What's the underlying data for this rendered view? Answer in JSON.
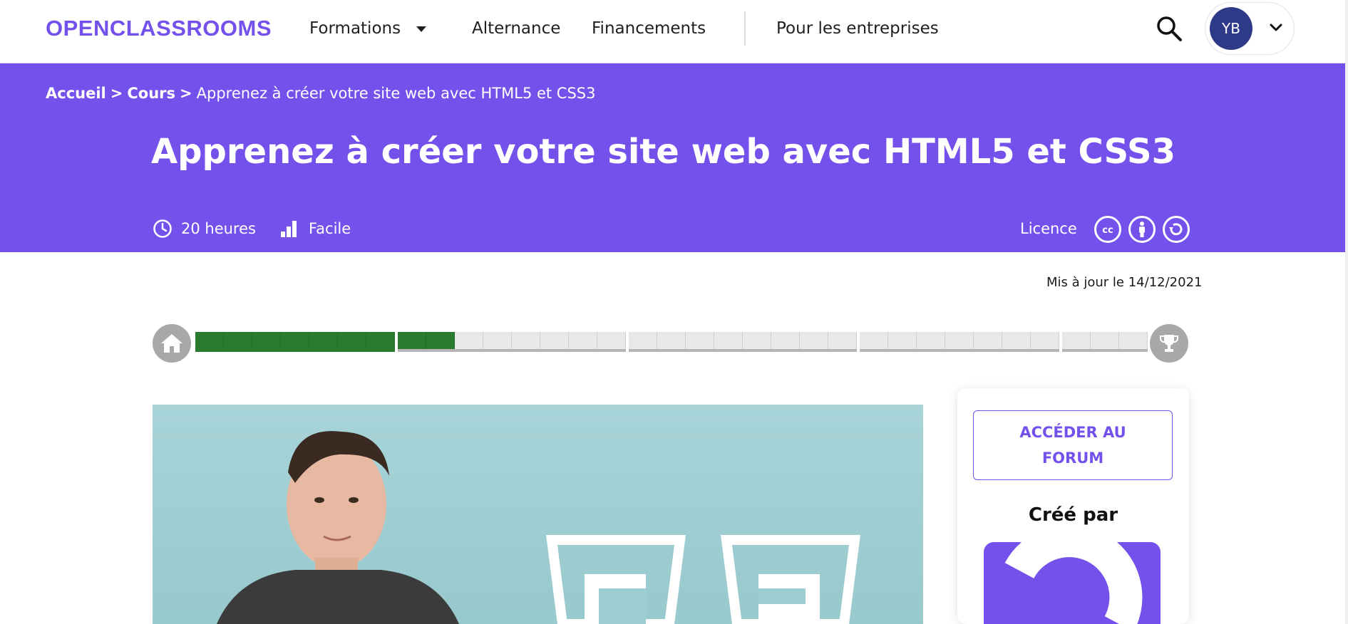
{
  "header": {
    "logo_text": "OPENCLASSROOMS",
    "nav": {
      "formations": "Formations",
      "alternance": "Alternance",
      "financements": "Financements",
      "entreprises": "Pour les entreprises"
    },
    "account_initials": "YB"
  },
  "banner": {
    "breadcrumb": {
      "home": "Accueil",
      "sep": ">",
      "courses": "Cours",
      "current": "Apprenez à créer votre site web avec HTML5 et CSS3"
    },
    "title": "Apprenez à créer votre site web avec HTML5 et CSS3",
    "duration": "20 heures",
    "level": "Facile",
    "licence_label": "Licence",
    "licence_icons": [
      "cc-icon",
      "by-icon",
      "sa-icon"
    ]
  },
  "content": {
    "updated": "Mis à jour le 14/12/2021"
  },
  "progress": {
    "parts": [
      {
        "total": 7,
        "done": 7
      },
      {
        "total": 8,
        "done": 2
      },
      {
        "total": 8,
        "done": 0
      },
      {
        "total": 7,
        "done": 0
      },
      {
        "total": 3,
        "done": 0
      }
    ]
  },
  "sidebar": {
    "forum_button": "ACCÉDER AU FORUM",
    "created_by": "Créé par"
  },
  "colors": {
    "brand": "#7451eb",
    "progress_done": "#2a7a2f",
    "avatar_bg": "#2e3a87"
  }
}
